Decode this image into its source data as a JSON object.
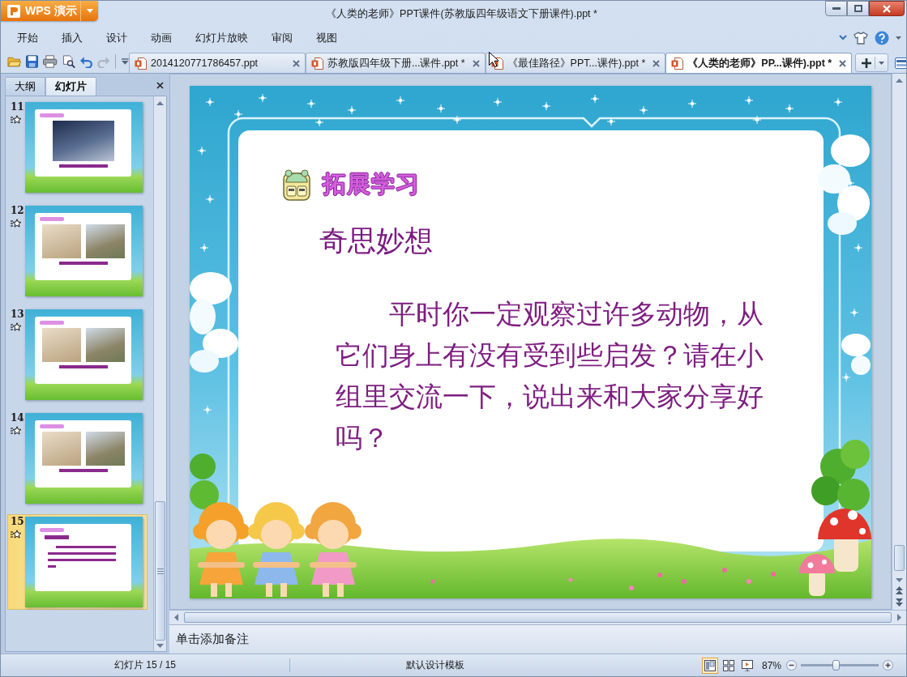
{
  "app_button": {
    "label": "WPS 演示"
  },
  "window": {
    "title": "《人类的老师》PPT课件(苏教版四年级语文下册课件).ppt *"
  },
  "menu": [
    {
      "label": "开始"
    },
    {
      "label": "插入"
    },
    {
      "label": "设计"
    },
    {
      "label": "动画"
    },
    {
      "label": "幻灯片放映"
    },
    {
      "label": "审阅"
    },
    {
      "label": "视图"
    }
  ],
  "quick_access": [
    {
      "kind": "open",
      "disabled": false
    },
    {
      "kind": "save",
      "disabled": false
    },
    {
      "kind": "print",
      "disabled": false
    },
    {
      "kind": "preview",
      "disabled": false
    },
    {
      "kind": "undo",
      "disabled": false
    },
    {
      "kind": "redo",
      "disabled": true
    }
  ],
  "doc_tabs": [
    {
      "label": "2014120771786457.ppt",
      "selected": false
    },
    {
      "label": "苏教版四年级下册...课件.ppt *",
      "selected": false
    },
    {
      "label": "《最佳路径》PPT...课件).ppt *",
      "selected": false
    },
    {
      "label": "《人类的老师》PP...课件).ppt *",
      "selected": true
    }
  ],
  "panel_tabs": [
    {
      "label": "大纲",
      "selected": false
    },
    {
      "label": "幻灯片",
      "selected": true
    }
  ],
  "slides": [
    {
      "number": "11",
      "kind": "single-photo",
      "selected": false
    },
    {
      "number": "12",
      "kind": "two-photos",
      "selected": false
    },
    {
      "number": "13",
      "kind": "two-photos",
      "selected": false
    },
    {
      "number": "14",
      "kind": "two-photos",
      "selected": false
    },
    {
      "number": "15",
      "kind": "text",
      "selected": true
    }
  ],
  "slide": {
    "heading": "拓展学习",
    "title": "奇思妙想",
    "body": "平时你一定观察过许多动物，从它们身上有没有受到些启发？请在小组里交流一下，说出来和大家分享好吗？"
  },
  "notes": {
    "placeholder": "单击添加备注"
  },
  "status_bar": {
    "slide_counter": "幻灯片 15 / 15",
    "template": "默认设计模板",
    "view_buttons": [
      {
        "kind": "normal",
        "selected": true
      },
      {
        "kind": "sorter",
        "selected": false
      },
      {
        "kind": "show",
        "selected": false
      }
    ],
    "zoom": {
      "reading": "87%",
      "level": 0.45
    }
  }
}
